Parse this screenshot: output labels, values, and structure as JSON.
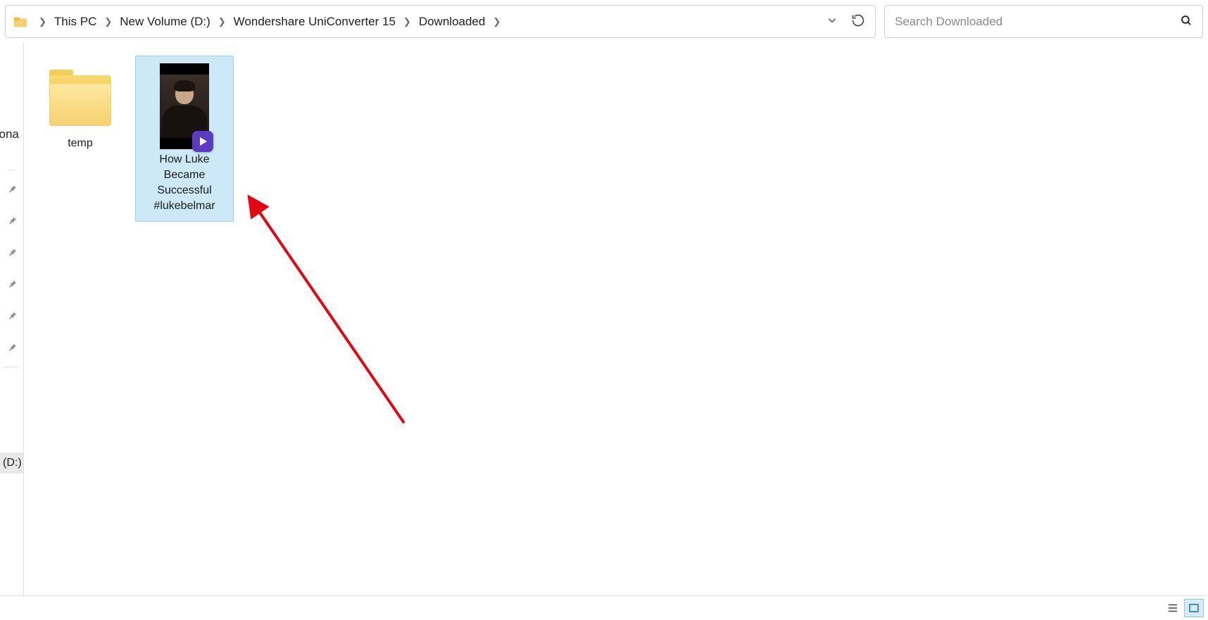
{
  "breadcrumbs": {
    "items": [
      "This PC",
      "New Volume (D:)",
      "Wondershare UniConverter 15",
      "Downloaded"
    ]
  },
  "search": {
    "placeholder": "Search Downloaded"
  },
  "sidebar": {
    "partial_label": "sona",
    "drive_label": "(D:)"
  },
  "files": {
    "folder": {
      "name": "temp"
    },
    "video": {
      "name": "How Luke Became Successful #lukebelmar"
    }
  },
  "view": {
    "details_active": false,
    "large_active": true
  }
}
